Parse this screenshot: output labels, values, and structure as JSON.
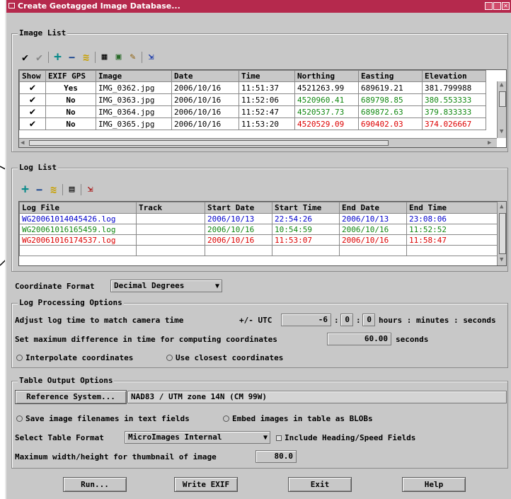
{
  "window": {
    "title": "Create Geotagged Image Database..."
  },
  "image_list": {
    "legend": "Image List",
    "columns": [
      "Show",
      "EXIF GPS",
      "Image",
      "Date",
      "Time",
      "Northing",
      "Easting",
      "Elevation"
    ],
    "rows": [
      {
        "show": "✔",
        "exif": "Yes",
        "image": "IMG_0362.jpg",
        "date": "2006/10/16",
        "time": "11:51:37",
        "northing": "4521263.99",
        "easting": "689619.21",
        "elevation": "381.799988",
        "color": "#000000"
      },
      {
        "show": "✔",
        "exif": "No",
        "image": "IMG_0363.jpg",
        "date": "2006/10/16",
        "time": "11:52:06",
        "northing": "4520960.41",
        "easting": "689798.85",
        "elevation": "380.553333",
        "color": "#118811"
      },
      {
        "show": "✔",
        "exif": "No",
        "image": "IMG_0364.jpg",
        "date": "2006/10/16",
        "time": "11:52:47",
        "northing": "4520537.73",
        "easting": "689872.63",
        "elevation": "379.833333",
        "color": "#118811"
      },
      {
        "show": "✔",
        "exif": "No",
        "image": "IMG_0365.jpg",
        "date": "2006/10/16",
        "time": "11:53:20",
        "northing": "4520529.09",
        "easting": "690402.03",
        "elevation": "374.026667",
        "color": "#dd0000"
      }
    ]
  },
  "log_list": {
    "legend": "Log List",
    "columns": [
      "Log File",
      "Track",
      "Start Date",
      "Start Time",
      "End Date",
      "End Time"
    ],
    "rows": [
      {
        "file": "WG20061014045426.log",
        "track": "",
        "start_date": "2006/10/13",
        "start_time": "22:54:26",
        "end_date": "2006/10/13",
        "end_time": "23:08:06",
        "color": "#0000cc"
      },
      {
        "file": "WG20061016165459.log",
        "track": "",
        "start_date": "2006/10/16",
        "start_time": "10:54:59",
        "end_date": "2006/10/16",
        "end_time": "11:52:52",
        "color": "#118811"
      },
      {
        "file": "WG20061016174537.log",
        "track": "",
        "start_date": "2006/10/16",
        "start_time": "11:53:07",
        "end_date": "2006/10/16",
        "end_time": "11:58:47",
        "color": "#dd0000"
      }
    ]
  },
  "coord_format": {
    "label": "Coordinate Format",
    "value": "Decimal Degrees"
  },
  "log_processing": {
    "legend": "Log Processing Options",
    "adjust_label": "Adjust log time to match camera time",
    "utc_label": "+/- UTC",
    "hours": "-6",
    "minutes": "0",
    "seconds": "0",
    "units_label": "hours : minutes : seconds",
    "maxdiff_label": "Set maximum difference in time for computing coordinates",
    "maxdiff_value": "60.00",
    "maxdiff_unit": "seconds",
    "interpolate_label": "Interpolate coordinates",
    "closest_label": "Use closest coordinates"
  },
  "table_output": {
    "legend": "Table Output Options",
    "refsys_button": "Reference System...",
    "refsys_value": "NAD83 / UTM zone 14N (CM 99W)",
    "save_filenames_label": "Save image filenames in text fields",
    "embed_label": "Embed images in table as BLOBs",
    "format_label": "Select Table Format",
    "format_value": "MicroImages Internal",
    "heading_label": "Include Heading/Speed Fields",
    "thumb_label": "Maximum width/height for thumbnail of image",
    "thumb_value": "80.0"
  },
  "buttons": {
    "run": "Run...",
    "write": "Write EXIF",
    "exit": "Exit",
    "help": "Help"
  }
}
